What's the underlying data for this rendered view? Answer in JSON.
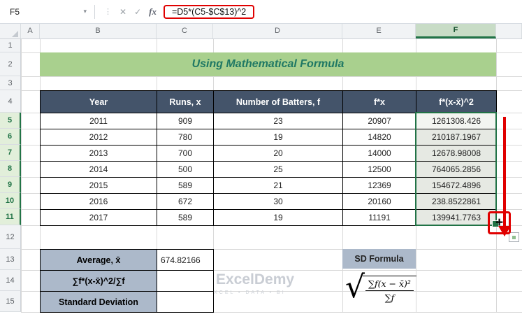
{
  "formula_bar": {
    "cell_ref": "F5",
    "formula": "=D5*(C5-$C$13)^2",
    "icons": {
      "caret": "▾",
      "dots": "⋮",
      "cancel": "✕",
      "enter": "✓",
      "fx": "fx"
    }
  },
  "columns": [
    "A",
    "B",
    "C",
    "D",
    "E",
    "F"
  ],
  "row_numbers": [
    "1",
    "2",
    "3",
    "4",
    "5",
    "6",
    "7",
    "8",
    "9",
    "10",
    "11",
    "12",
    "13",
    "14",
    "15"
  ],
  "title": "Using Mathematical Formula",
  "table": {
    "headers": [
      "Year",
      "Runs, x",
      "Number of Batters, f",
      "f*x",
      "f*(x-x̄)^2"
    ],
    "rows": [
      [
        "2011",
        "909",
        "23",
        "20907",
        "1261308.426"
      ],
      [
        "2012",
        "780",
        "19",
        "14820",
        "210187.1967"
      ],
      [
        "2013",
        "700",
        "20",
        "14000",
        "12678.98008"
      ],
      [
        "2014",
        "500",
        "25",
        "12500",
        "764065.2856"
      ],
      [
        "2015",
        "589",
        "21",
        "12369",
        "154672.4896"
      ],
      [
        "2016",
        "672",
        "30",
        "20160",
        "238.8522861"
      ],
      [
        "2017",
        "589",
        "19",
        "11191",
        "139941.7763"
      ]
    ]
  },
  "summary": {
    "labels": [
      "Average, x̄",
      "∑f*(x-x̄)^2/∑f",
      "Standard Deviation"
    ],
    "values": [
      "674.82166",
      "",
      ""
    ]
  },
  "sd": {
    "label": "SD Formula",
    "numerator": "∑f(x − x̄)²",
    "denominator": "∑f"
  },
  "annotations": {
    "fill_cursor": "+"
  },
  "watermark": {
    "name": "ExcelDemy",
    "tagline": "EXCEL • DATA • BI"
  },
  "colors": {
    "accent_green": "#217346",
    "table_header_fill": "#44546A",
    "title_fill": "#A9D08E",
    "title_text": "#1F7864",
    "label_fill": "#ACB9CA",
    "annotation_red": "#E00000"
  }
}
